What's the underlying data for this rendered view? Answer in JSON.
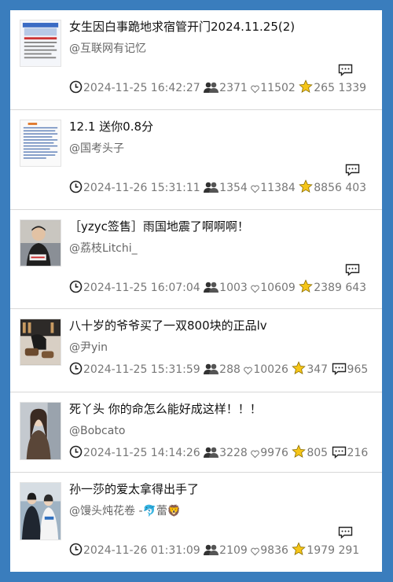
{
  "colors": {
    "background": "#3a7dbd",
    "card": "#ffffff",
    "title": "#111111",
    "meta": "#777777",
    "star": "#f5c518"
  },
  "icons": {
    "time": "clock-icon",
    "views": "people-icon",
    "likes": "heart-icon",
    "favorites": "star-icon",
    "comments": "comment-icon"
  },
  "items": [
    {
      "title": "女生因白事跪地求宿管开门2024.11.25(2)",
      "author": "@互联网有记忆",
      "time": "2024-11-25 16:42:27",
      "views": "2371",
      "likes": "11502",
      "favorites": "265",
      "comments": "1339"
    },
    {
      "title": "12.1 送你0.8分",
      "author": "@国考头子",
      "time": "2024-11-26 15:31:11",
      "views": "1354",
      "likes": "11384",
      "favorites": "8856",
      "comments": "403"
    },
    {
      "title": "［yzyc签售］雨国地震了啊啊啊！",
      "author": "@荔枝Litchi_",
      "time": "2024-11-25 16:07:04",
      "views": "1003",
      "likes": "10609",
      "favorites": "2389",
      "comments": "643"
    },
    {
      "title": "八十岁的爷爷买了一双800块的正品lv",
      "author": "@尹yin",
      "time": "2024-11-25 15:31:59",
      "views": "288",
      "likes": "10026",
      "favorites": "347",
      "comments": "965"
    },
    {
      "title": "死丫头 你的命怎么能好成这样！！！",
      "author": "@Bobcato",
      "time": "2024-11-25 14:14:26",
      "views": "3228",
      "likes": "9976",
      "favorites": "805",
      "comments": "216"
    },
    {
      "title": "孙一莎的爱太拿得出手了",
      "author": "@馒头炖花卷 -🐬蕾🦁",
      "time": "2024-11-26 01:31:09",
      "views": "2109",
      "likes": "9836",
      "favorites": "1979",
      "comments": "291"
    }
  ]
}
